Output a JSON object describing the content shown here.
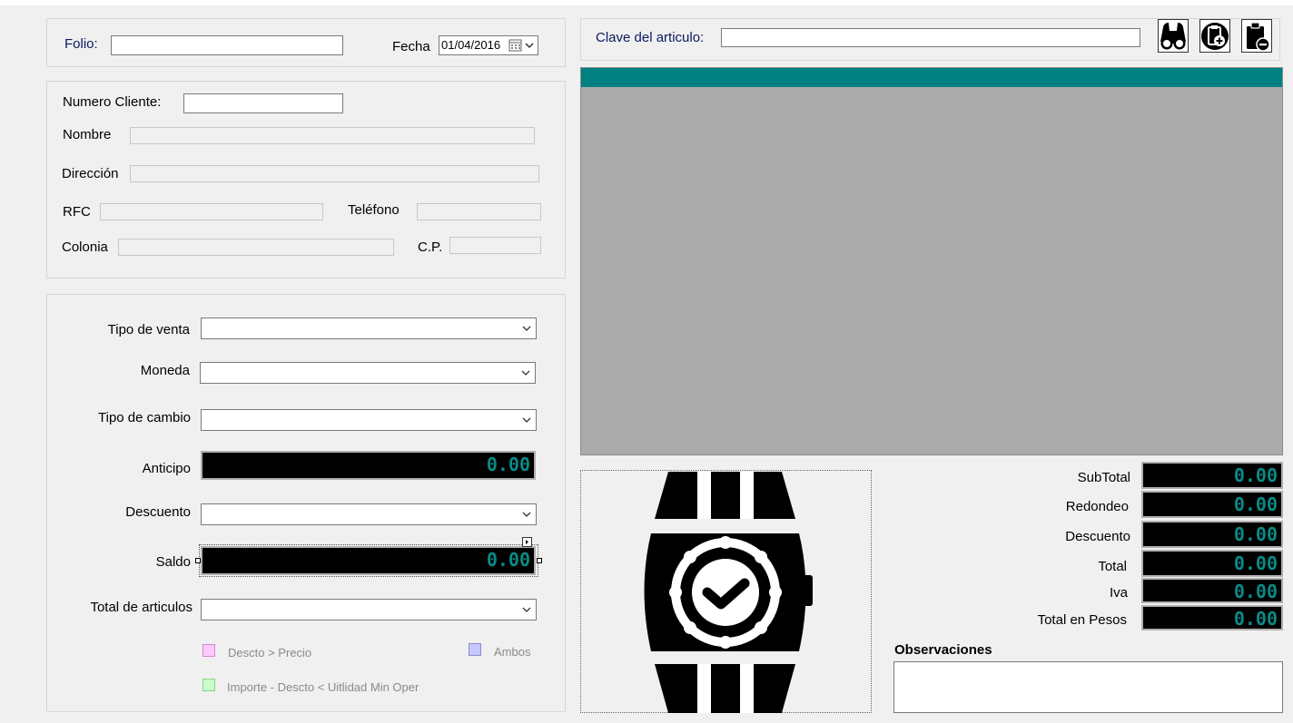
{
  "header": {
    "folio_label": "Folio:",
    "folio_value": "",
    "fecha_label": "Fecha",
    "fecha_value": "01/04/2016"
  },
  "cliente": {
    "numero_label": "Numero Cliente:",
    "numero_value": "",
    "nombre_label": "Nombre",
    "direccion_label": "Dirección",
    "rfc_label": "RFC",
    "telefono_label": "Teléfono",
    "colonia_label": "Colonia",
    "cp_label": "C.P."
  },
  "venta": {
    "tipo_venta_label": "Tipo de venta",
    "moneda_label": "Moneda",
    "tipo_cambio_label": "Tipo de cambio",
    "anticipo_label": "Anticipo",
    "anticipo_value": "0.00",
    "descuento_label": "Descuento",
    "saldo_label": "Saldo",
    "saldo_value": "0.00",
    "total_articulos_label": "Total de articulos"
  },
  "legend": {
    "descto_precio": "Descto > Precio",
    "ambos": "Ambos",
    "importe_utilidad": "Importe - Descto < Uitlidad Min Oper",
    "colors": {
      "descto_precio": "#ffc8ff",
      "ambos": "#c8c8ff",
      "importe_utilidad": "#c8ffc8"
    }
  },
  "articulo": {
    "clave_label": "Clave del articulo:",
    "clave_value": "",
    "icons": [
      "binoculars-icon",
      "add-clipboard-icon",
      "remove-clipboard-icon"
    ]
  },
  "totales": {
    "subtotal_label": "SubTotal",
    "subtotal_value": "0.00",
    "redondeo_label": "Redondeo",
    "redondeo_value": "0.00",
    "descuento_label": "Descuento",
    "descuento_value": "0.00",
    "total_label": "Total",
    "total_value": "0.00",
    "iva_label": "Iva",
    "iva_value": "0.00",
    "total_pesos_label": "Total en Pesos",
    "total_pesos_value": "0.00"
  },
  "observaciones": {
    "label": "Observaciones",
    "value": ""
  },
  "colors": {
    "grid_header": "#008080",
    "grid_bg": "#ababab",
    "number_fg": "#0a8a86"
  },
  "image": {
    "icon": "wristwatch-icon"
  }
}
